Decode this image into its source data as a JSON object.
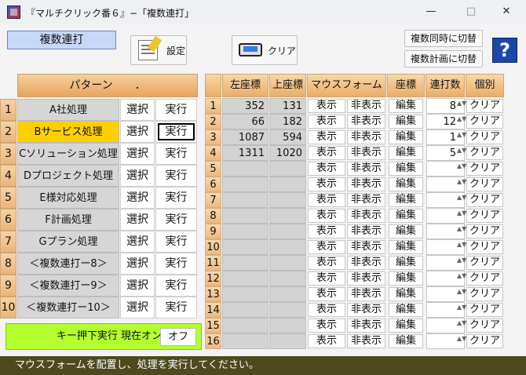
{
  "window": {
    "title": "『マルチクリック番６』−「複数連打」",
    "buttons": {
      "minimize": "—",
      "maximize": "□",
      "close": "✕"
    }
  },
  "mode_label": "複数連打",
  "toolbar": {
    "settings_label": "設定",
    "clear_label": "クリア",
    "switch_simultaneous": "複数同時に切替",
    "switch_plan": "複数計画に切替",
    "help": "?"
  },
  "patterns": {
    "header": "パターン　　．",
    "select_label": "選択",
    "run_label": "実行",
    "rows": [
      {
        "num": "1",
        "name": "A社処理"
      },
      {
        "num": "2",
        "name": "Bサービス処理",
        "selected": true
      },
      {
        "num": "3",
        "name": "Cソリューション処理"
      },
      {
        "num": "4",
        "name": "Dプロジェクト処理"
      },
      {
        "num": "5",
        "name": "E様対応処理"
      },
      {
        "num": "6",
        "name": "F計画処理"
      },
      {
        "num": "7",
        "name": "Gプラン処理"
      },
      {
        "num": "8",
        "name": "＜複数連打ー8＞"
      },
      {
        "num": "9",
        "name": "＜複数連打ー9＞"
      },
      {
        "num": "10",
        "name": "＜複数連打ー10＞"
      }
    ]
  },
  "keybar": {
    "label": "キー押下実行 現在オン",
    "button": "オフ"
  },
  "grid": {
    "headers": {
      "left": "左座標",
      "top": "上座標",
      "mouse_form": "マウスフォーム",
      "coords": "座標",
      "count": "連打数",
      "each": "個別"
    },
    "button_labels": {
      "show": "表示",
      "hide": "非表示",
      "edit": "編集",
      "clear": "クリア"
    },
    "rows": [
      {
        "num": "1",
        "left": "352",
        "top": "131",
        "count": "8"
      },
      {
        "num": "2",
        "left": "66",
        "top": "182",
        "count": "12"
      },
      {
        "num": "3",
        "left": "1087",
        "top": "594",
        "count": "1"
      },
      {
        "num": "4",
        "left": "1311",
        "top": "1020",
        "count": "5"
      },
      {
        "num": "5",
        "left": "",
        "top": "",
        "count": ""
      },
      {
        "num": "6",
        "left": "",
        "top": "",
        "count": ""
      },
      {
        "num": "7",
        "left": "",
        "top": "",
        "count": ""
      },
      {
        "num": "8",
        "left": "",
        "top": "",
        "count": ""
      },
      {
        "num": "9",
        "left": "",
        "top": "",
        "count": ""
      },
      {
        "num": "10",
        "left": "",
        "top": "",
        "count": ""
      },
      {
        "num": "11",
        "left": "",
        "top": "",
        "count": ""
      },
      {
        "num": "12",
        "left": "",
        "top": "",
        "count": ""
      },
      {
        "num": "13",
        "left": "",
        "top": "",
        "count": ""
      },
      {
        "num": "14",
        "left": "",
        "top": "",
        "count": ""
      },
      {
        "num": "15",
        "left": "",
        "top": "",
        "count": ""
      },
      {
        "num": "16",
        "left": "",
        "top": "",
        "count": ""
      }
    ]
  },
  "status": "マウスフォームを配置し、処理を実行してください。"
}
